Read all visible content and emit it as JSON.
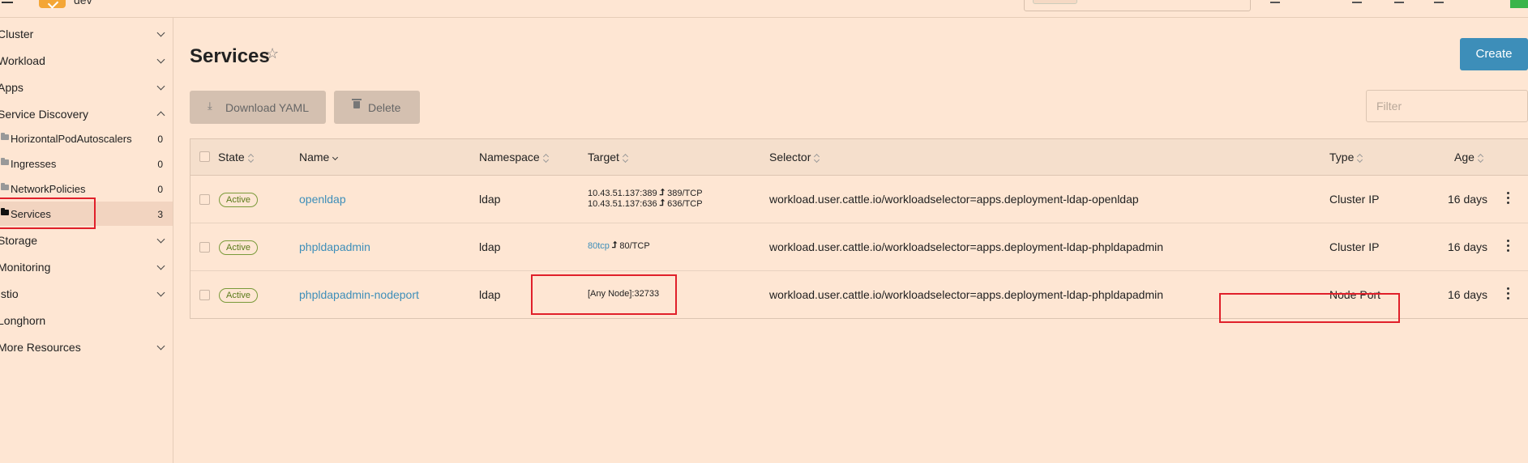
{
  "topbar": {
    "cluster_name": "dev"
  },
  "sidebar": {
    "groups": [
      {
        "label": "Cluster",
        "expanded": false
      },
      {
        "label": "Workload",
        "expanded": false
      },
      {
        "label": "Apps",
        "expanded": false
      },
      {
        "label": "Service Discovery",
        "expanded": true
      },
      {
        "label": "Storage",
        "expanded": false
      },
      {
        "label": "Monitoring",
        "expanded": false
      },
      {
        "label": "Istio",
        "expanded": false
      },
      {
        "label": "Longhorn",
        "expanded": false
      },
      {
        "label": "More Resources",
        "expanded": false
      }
    ],
    "items": [
      {
        "label": "HorizontalPodAutoscalers",
        "count": "0"
      },
      {
        "label": "Ingresses",
        "count": "0"
      },
      {
        "label": "NetworkPolicies",
        "count": "0"
      },
      {
        "label": "Services",
        "count": "3",
        "active": true
      }
    ]
  },
  "page": {
    "title": "Services",
    "create_label": "Create",
    "download_label": "Download YAML",
    "delete_label": "Delete",
    "filter_placeholder": "Filter"
  },
  "table": {
    "headers": {
      "state": "State",
      "name": "Name",
      "namespace": "Namespace",
      "target": "Target",
      "selector": "Selector",
      "type": "Type",
      "age": "Age"
    },
    "rows": [
      {
        "state": "Active",
        "name": "openldap",
        "namespace": "ldap",
        "target_lines": [
          {
            "from": "10.43.51.137:389",
            "to": "389/TCP"
          },
          {
            "from": "10.43.51.137:636",
            "to": "636/TCP"
          }
        ],
        "selector": "workload.user.cattle.io/workloadselector=apps.deployment-ldap-openldap",
        "type": "Cluster IP",
        "age": "16 days"
      },
      {
        "state": "Active",
        "name": "phpldapadmin",
        "namespace": "ldap",
        "target_lines": [
          {
            "from": "80tcp",
            "to": "80/TCP"
          }
        ],
        "selector": "workload.user.cattle.io/workloadselector=apps.deployment-ldap-phpldapadmin",
        "type": "Cluster IP",
        "age": "16 days"
      },
      {
        "state": "Active",
        "name": "phpldapadmin-nodeport",
        "namespace": "ldap",
        "target_text": "[Any Node]:32733",
        "selector": "workload.user.cattle.io/workloadselector=apps.deployment-ldap-phpldapadmin",
        "type": "Node Port",
        "age": "16 days"
      }
    ]
  },
  "colors": {
    "background": "#fee6d3",
    "accent": "#3d8eb9",
    "active_badge": "#5a7a1a",
    "annotation": "#e0202a"
  }
}
